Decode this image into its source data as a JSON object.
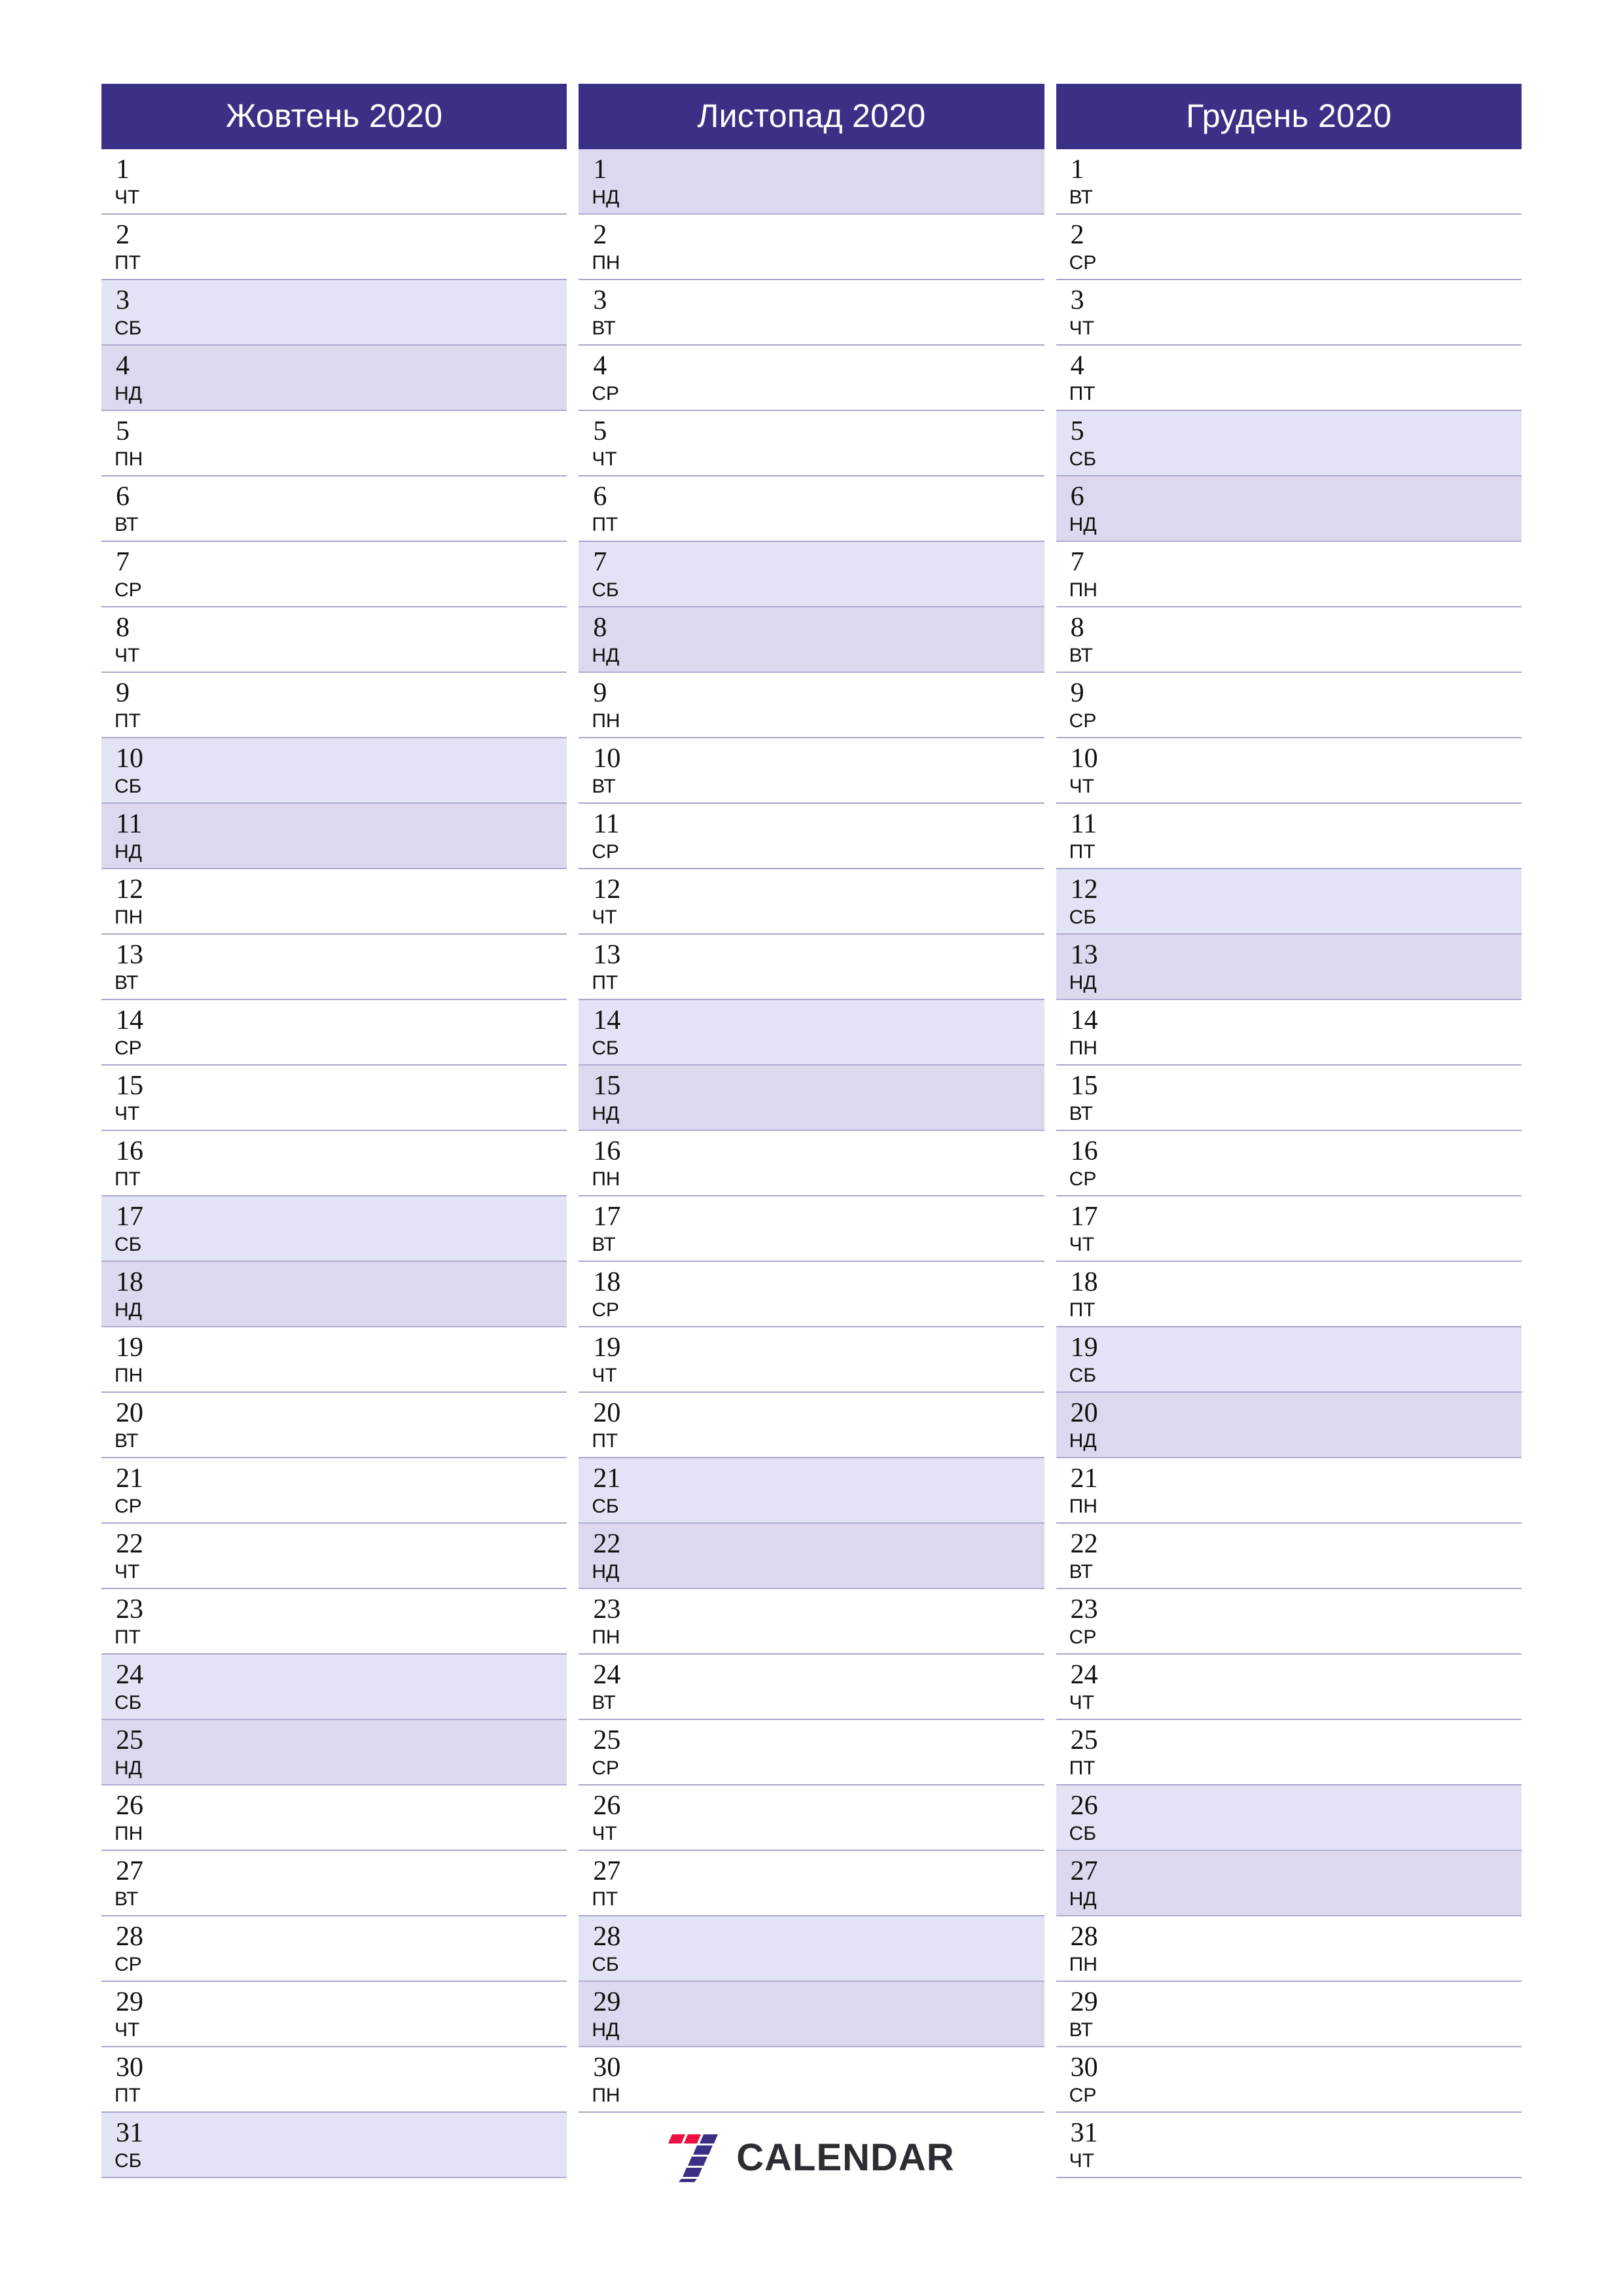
{
  "theme": {
    "header_bg": "#3a3187",
    "header_text": "#ffffff",
    "saturday_bg": "#e2e3f4",
    "sunday_bg": "#ddd8ee",
    "row_divider": "#a9a5cb",
    "day_text": "#111111",
    "logo_red": "#ec0f3f",
    "logo_navy": "#3a3187",
    "logo_text": "#2d2d33"
  },
  "logo": {
    "mark_name": "seven-logo-icon",
    "text": "CALENDAR"
  },
  "months": [
    {
      "title": "Жовтень 2020",
      "days": [
        {
          "num": "1",
          "dow": "ЧТ",
          "type": "weekday"
        },
        {
          "num": "2",
          "dow": "ПТ",
          "type": "weekday"
        },
        {
          "num": "3",
          "dow": "СБ",
          "type": "sat"
        },
        {
          "num": "4",
          "dow": "НД",
          "type": "sun"
        },
        {
          "num": "5",
          "dow": "ПН",
          "type": "weekday"
        },
        {
          "num": "6",
          "dow": "ВТ",
          "type": "weekday"
        },
        {
          "num": "7",
          "dow": "СР",
          "type": "weekday"
        },
        {
          "num": "8",
          "dow": "ЧТ",
          "type": "weekday"
        },
        {
          "num": "9",
          "dow": "ПТ",
          "type": "weekday"
        },
        {
          "num": "10",
          "dow": "СБ",
          "type": "sat"
        },
        {
          "num": "11",
          "dow": "НД",
          "type": "sun"
        },
        {
          "num": "12",
          "dow": "ПН",
          "type": "weekday"
        },
        {
          "num": "13",
          "dow": "ВТ",
          "type": "weekday"
        },
        {
          "num": "14",
          "dow": "СР",
          "type": "weekday"
        },
        {
          "num": "15",
          "dow": "ЧТ",
          "type": "weekday"
        },
        {
          "num": "16",
          "dow": "ПТ",
          "type": "weekday"
        },
        {
          "num": "17",
          "dow": "СБ",
          "type": "sat"
        },
        {
          "num": "18",
          "dow": "НД",
          "type": "sun"
        },
        {
          "num": "19",
          "dow": "ПН",
          "type": "weekday"
        },
        {
          "num": "20",
          "dow": "ВТ",
          "type": "weekday"
        },
        {
          "num": "21",
          "dow": "СР",
          "type": "weekday"
        },
        {
          "num": "22",
          "dow": "ЧТ",
          "type": "weekday"
        },
        {
          "num": "23",
          "dow": "ПТ",
          "type": "weekday"
        },
        {
          "num": "24",
          "dow": "СБ",
          "type": "sat"
        },
        {
          "num": "25",
          "dow": "НД",
          "type": "sun"
        },
        {
          "num": "26",
          "dow": "ПН",
          "type": "weekday"
        },
        {
          "num": "27",
          "dow": "ВТ",
          "type": "weekday"
        },
        {
          "num": "28",
          "dow": "СР",
          "type": "weekday"
        },
        {
          "num": "29",
          "dow": "ЧТ",
          "type": "weekday"
        },
        {
          "num": "30",
          "dow": "ПТ",
          "type": "weekday"
        },
        {
          "num": "31",
          "dow": "СБ",
          "type": "sat"
        }
      ],
      "has_logo": false
    },
    {
      "title": "Листопад 2020",
      "days": [
        {
          "num": "1",
          "dow": "НД",
          "type": "sun"
        },
        {
          "num": "2",
          "dow": "ПН",
          "type": "weekday"
        },
        {
          "num": "3",
          "dow": "ВТ",
          "type": "weekday"
        },
        {
          "num": "4",
          "dow": "СР",
          "type": "weekday"
        },
        {
          "num": "5",
          "dow": "ЧТ",
          "type": "weekday"
        },
        {
          "num": "6",
          "dow": "ПТ",
          "type": "weekday"
        },
        {
          "num": "7",
          "dow": "СБ",
          "type": "sat"
        },
        {
          "num": "8",
          "dow": "НД",
          "type": "sun"
        },
        {
          "num": "9",
          "dow": "ПН",
          "type": "weekday"
        },
        {
          "num": "10",
          "dow": "ВТ",
          "type": "weekday"
        },
        {
          "num": "11",
          "dow": "СР",
          "type": "weekday"
        },
        {
          "num": "12",
          "dow": "ЧТ",
          "type": "weekday"
        },
        {
          "num": "13",
          "dow": "ПТ",
          "type": "weekday"
        },
        {
          "num": "14",
          "dow": "СБ",
          "type": "sat"
        },
        {
          "num": "15",
          "dow": "НД",
          "type": "sun"
        },
        {
          "num": "16",
          "dow": "ПН",
          "type": "weekday"
        },
        {
          "num": "17",
          "dow": "ВТ",
          "type": "weekday"
        },
        {
          "num": "18",
          "dow": "СР",
          "type": "weekday"
        },
        {
          "num": "19",
          "dow": "ЧТ",
          "type": "weekday"
        },
        {
          "num": "20",
          "dow": "ПТ",
          "type": "weekday"
        },
        {
          "num": "21",
          "dow": "СБ",
          "type": "sat"
        },
        {
          "num": "22",
          "dow": "НД",
          "type": "sun"
        },
        {
          "num": "23",
          "dow": "ПН",
          "type": "weekday"
        },
        {
          "num": "24",
          "dow": "ВТ",
          "type": "weekday"
        },
        {
          "num": "25",
          "dow": "СР",
          "type": "weekday"
        },
        {
          "num": "26",
          "dow": "ЧТ",
          "type": "weekday"
        },
        {
          "num": "27",
          "dow": "ПТ",
          "type": "weekday"
        },
        {
          "num": "28",
          "dow": "СБ",
          "type": "sat"
        },
        {
          "num": "29",
          "dow": "НД",
          "type": "sun"
        },
        {
          "num": "30",
          "dow": "ПН",
          "type": "weekday"
        }
      ],
      "has_logo": true
    },
    {
      "title": "Грудень 2020",
      "days": [
        {
          "num": "1",
          "dow": "ВТ",
          "type": "weekday"
        },
        {
          "num": "2",
          "dow": "СР",
          "type": "weekday"
        },
        {
          "num": "3",
          "dow": "ЧТ",
          "type": "weekday"
        },
        {
          "num": "4",
          "dow": "ПТ",
          "type": "weekday"
        },
        {
          "num": "5",
          "dow": "СБ",
          "type": "sat"
        },
        {
          "num": "6",
          "dow": "НД",
          "type": "sun"
        },
        {
          "num": "7",
          "dow": "ПН",
          "type": "weekday"
        },
        {
          "num": "8",
          "dow": "ВТ",
          "type": "weekday"
        },
        {
          "num": "9",
          "dow": "СР",
          "type": "weekday"
        },
        {
          "num": "10",
          "dow": "ЧТ",
          "type": "weekday"
        },
        {
          "num": "11",
          "dow": "ПТ",
          "type": "weekday"
        },
        {
          "num": "12",
          "dow": "СБ",
          "type": "sat"
        },
        {
          "num": "13",
          "dow": "НД",
          "type": "sun"
        },
        {
          "num": "14",
          "dow": "ПН",
          "type": "weekday"
        },
        {
          "num": "15",
          "dow": "ВТ",
          "type": "weekday"
        },
        {
          "num": "16",
          "dow": "СР",
          "type": "weekday"
        },
        {
          "num": "17",
          "dow": "ЧТ",
          "type": "weekday"
        },
        {
          "num": "18",
          "dow": "ПТ",
          "type": "weekday"
        },
        {
          "num": "19",
          "dow": "СБ",
          "type": "sat"
        },
        {
          "num": "20",
          "dow": "НД",
          "type": "sun"
        },
        {
          "num": "21",
          "dow": "ПН",
          "type": "weekday"
        },
        {
          "num": "22",
          "dow": "ВТ",
          "type": "weekday"
        },
        {
          "num": "23",
          "dow": "СР",
          "type": "weekday"
        },
        {
          "num": "24",
          "dow": "ЧТ",
          "type": "weekday"
        },
        {
          "num": "25",
          "dow": "ПТ",
          "type": "weekday"
        },
        {
          "num": "26",
          "dow": "СБ",
          "type": "sat"
        },
        {
          "num": "27",
          "dow": "НД",
          "type": "sun"
        },
        {
          "num": "28",
          "dow": "ПН",
          "type": "weekday"
        },
        {
          "num": "29",
          "dow": "ВТ",
          "type": "weekday"
        },
        {
          "num": "30",
          "dow": "СР",
          "type": "weekday"
        },
        {
          "num": "31",
          "dow": "ЧТ",
          "type": "weekday"
        }
      ],
      "has_logo": false
    }
  ]
}
